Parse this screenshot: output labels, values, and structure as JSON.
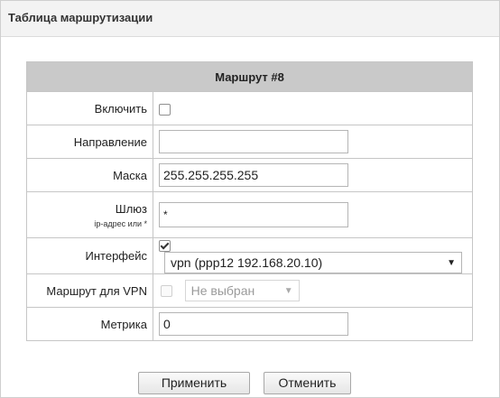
{
  "panel": {
    "title": "Таблица маршрутизации"
  },
  "route": {
    "caption": "Маршрут #8",
    "enable_label": "Включить",
    "enable_checked": false,
    "destination_label": "Направление",
    "destination_value": "",
    "mask_label": "Маска",
    "mask_value": "255.255.255.255",
    "gateway_label": "Шлюз",
    "gateway_hint": "ip-адрес или *",
    "gateway_value": "*",
    "interface_label": "Интерфейс",
    "interface_checked": true,
    "interface_value": "vpn (ppp12 192.168.20.10)",
    "vpn_route_label": "Маршрут для VPN",
    "vpn_route_checked": false,
    "vpn_route_value": "Не выбран",
    "metric_label": "Метрика",
    "metric_value": "0"
  },
  "buttons": {
    "apply": "Применить",
    "cancel": "Отменить"
  },
  "icons": {
    "dropdown": "▼"
  }
}
